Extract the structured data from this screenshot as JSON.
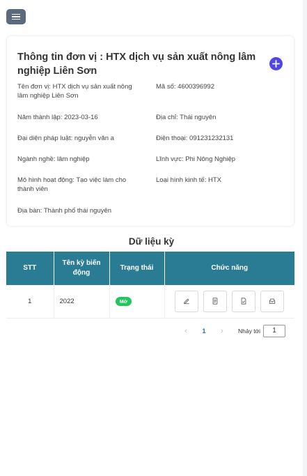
{
  "header": {
    "menu_icon": "hamburger-icon"
  },
  "info": {
    "title": "Thông tin đơn vị : HTX dịch vụ sản xuất nông lâm nghiệp Liên Sơn",
    "add_icon": "plus-icon",
    "fields": {
      "ten_don_vi": "Tên đơn vị: HTX dịch vụ sản xuất nông lâm nghiệp Liên Sơn",
      "ma_so": "Mã số: 4600396992",
      "nam_thanh_lap": "Năm thành lập: 2023-03-16",
      "dia_chi": "Địa chỉ: Thái nguyên",
      "dai_dien": "Đại diện pháp luật: nguyễn văn a",
      "dien_thoai": "Điện thoại: 091231232131",
      "nganh_nghe": "Ngành nghề: lâm nghiệp",
      "linh_vuc": "Lĩnh vực: Phi Nông Nghiệp",
      "mo_hinh": "Mô hình hoạt động: Tạo việc làm cho thành viên",
      "loai_hinh": "Loại hình kinh tế: HTX",
      "dia_ban": "Địa bàn: Thành phố thái nguyên"
    }
  },
  "table": {
    "section_title": "Dữ liệu kỳ",
    "headers": [
      "STT",
      "Tên kỳ biến động",
      "Trạng thái",
      "Chức năng"
    ],
    "rows": [
      {
        "stt": "1",
        "ten_ky": "2022",
        "trang_thai": "Mở"
      }
    ],
    "action_icons": [
      "edit-icon",
      "document-icon",
      "file-check-icon",
      "archive-icon"
    ],
    "status_color": "#22c55e",
    "header_color": "#2a7c94"
  },
  "pagination": {
    "prev": "‹",
    "current": "1",
    "next": "›",
    "jump_label": "Nhảy tới",
    "jump_value": "1"
  }
}
